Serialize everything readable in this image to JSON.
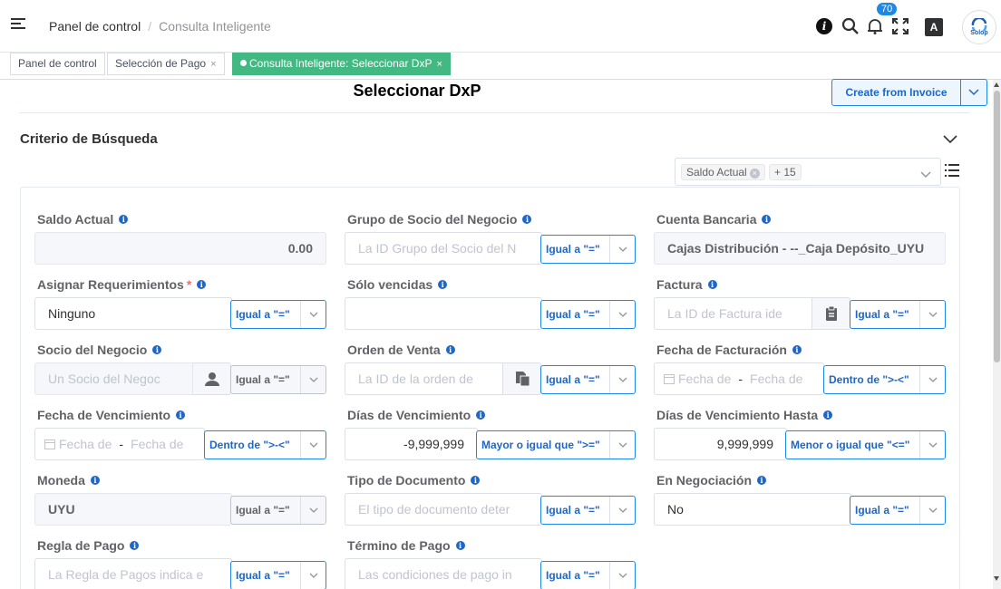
{
  "breadcrumb": {
    "home": "Panel de control",
    "current": "Consulta Inteligente"
  },
  "notifications": {
    "count": "70"
  },
  "lang_label": "A",
  "avatar_text": "Solop",
  "tabs": [
    {
      "label": "Panel de control"
    },
    {
      "label": "Selección de Pago",
      "close": "×"
    },
    {
      "label": "Consulta Inteligente: Seleccionar DxP",
      "close": "×"
    }
  ],
  "page_title": "Seleccionar DxP",
  "create_button": "Create from Invoice",
  "section_title": "Criterio de Búsqueda",
  "tag_selector": {
    "tag": "Saldo Actual",
    "more": "+ 15"
  },
  "fields": {
    "saldo_actual": {
      "label": "Saldo Actual",
      "value": "0.00"
    },
    "grupo_socio": {
      "label": "Grupo de Socio del Negocio",
      "placeholder": "La ID Grupo del Socio del N",
      "operator": "Igual a \"=\""
    },
    "cuenta_bancaria": {
      "label": "Cuenta Bancaria",
      "value": "Cajas Distribución - --_Caja Depósito_UYU"
    },
    "asignar_req": {
      "label": "Asignar Requerimientos",
      "required": "*",
      "value": "Ninguno",
      "operator": "Igual a \"=\""
    },
    "solo_vencidas": {
      "label": "Sólo vencidas",
      "operator": "Igual a \"=\""
    },
    "factura": {
      "label": "Factura",
      "placeholder": "La ID de Factura ide",
      "operator": "Igual a \"=\""
    },
    "socio_negocio": {
      "label": "Socio del Negocio",
      "placeholder": "Un Socio del Negoc",
      "operator": "Igual a \"=\""
    },
    "orden_venta": {
      "label": "Orden de Venta",
      "placeholder": "La ID de la orden de",
      "operator": "Igual a \"=\""
    },
    "fecha_facturacion": {
      "label": "Fecha de Facturación",
      "from": "Fecha de",
      "to": "Fecha de",
      "operator": "Dentro de \">-<\""
    },
    "fecha_vencimiento": {
      "label": "Fecha de Vencimiento",
      "from": "Fecha de",
      "to": "Fecha de",
      "operator": "Dentro de \">-<\""
    },
    "dias_vencimiento": {
      "label": "Días de Vencimiento",
      "value": "-9,999,999",
      "operator": "Mayor o igual que \">=\""
    },
    "dias_venc_hasta": {
      "label": "Días de Vencimiento Hasta",
      "value": "9,999,999",
      "operator": "Menor o igual que \"<=\""
    },
    "moneda": {
      "label": "Moneda",
      "value": "UYU",
      "operator": "Igual a \"=\""
    },
    "tipo_documento": {
      "label": "Tipo de Documento",
      "placeholder": "El tipo de documento deter",
      "operator": "Igual a \"=\""
    },
    "en_negociacion": {
      "label": "En Negociación",
      "value": "No",
      "operator": "Igual a \"=\""
    },
    "regla_pago": {
      "label": "Regla de Pago",
      "placeholder": "La Regla de Pagos indica e",
      "operator": "Igual a \"=\""
    },
    "termino_pago": {
      "label": "Término de Pago",
      "placeholder": "Las condiciones de pago in",
      "operator": "Igual a \"=\""
    }
  },
  "colors": {
    "accent": "#1e88e5",
    "active_tab": "#42b983"
  }
}
